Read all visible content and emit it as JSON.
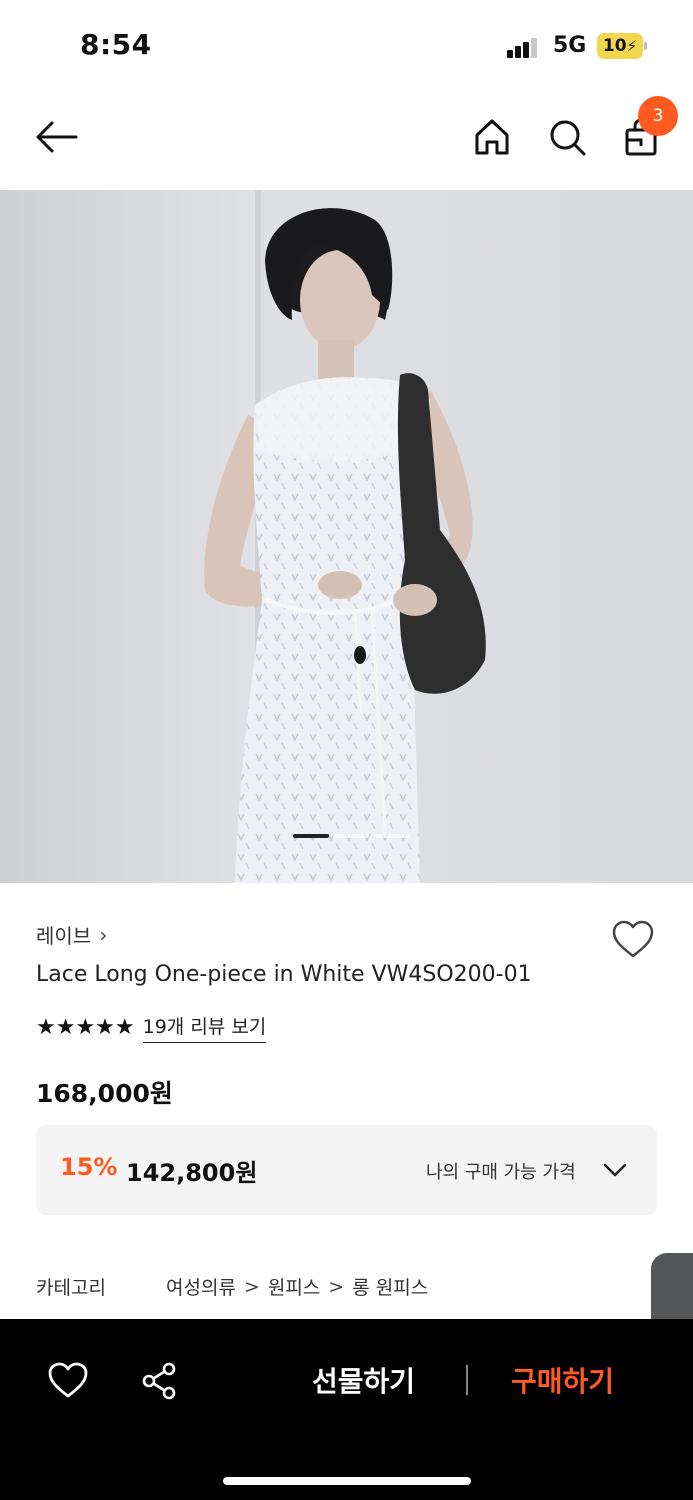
{
  "status_bar": {
    "time": "8:54",
    "network": "5G",
    "battery": "10"
  },
  "nav": {
    "back_icon": "arrow-left-icon",
    "home_icon": "home-icon",
    "search_icon": "search-icon",
    "bag_icon": "shopping-bag-icon",
    "cart_count": "3"
  },
  "gallery": {
    "image_description_icon": "product-photo",
    "page_count": 3,
    "active_index": 0
  },
  "product": {
    "brand": "레이브",
    "brand_chevron": "›",
    "name": "Lace Long One-piece in White VW4SO200-01",
    "rating": 5,
    "stars": "★★★★★",
    "review_link": "19개 리뷰 보기",
    "original_price": "168,000원",
    "discount_rate": "15%",
    "discount_price": "142,800원",
    "my_price_label": "나의 구매 가능 가격"
  },
  "category": {
    "label": "카테고리",
    "path": [
      "여성의류",
      "원피스",
      "롱 원피스"
    ],
    "separator": ">"
  },
  "side_tab": {
    "chevron": "‹"
  },
  "bottom_bar": {
    "gift_label": "선물하기",
    "buy_label": "구매하기"
  },
  "colors": {
    "accent": "#ff5a1f",
    "bottom_bar_bg": "#000000",
    "discount_box_bg": "#f4f4f5"
  }
}
